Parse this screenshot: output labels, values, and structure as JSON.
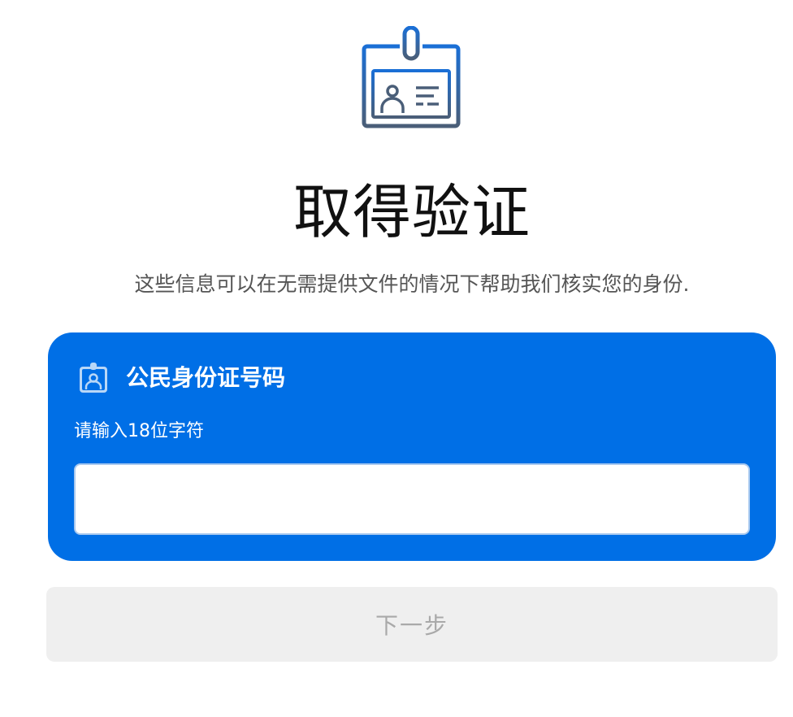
{
  "header": {
    "icon": "id-badge-icon",
    "title": "取得验证",
    "subtitle": "这些信息可以在无需提供文件的情况下帮助我们核实您的身份."
  },
  "id_card": {
    "icon": "id-badge-icon",
    "title": "公民身份证号码",
    "hint": "请输入18位字符",
    "value": "",
    "placeholder": ""
  },
  "actions": {
    "next_label": "下一步"
  },
  "colors": {
    "accent": "#006fe6",
    "icon_stroke_top": "#1a6fd6",
    "icon_stroke_bottom": "#4a5e78",
    "button_bg": "#efefef",
    "button_text": "#a9a9a9"
  }
}
